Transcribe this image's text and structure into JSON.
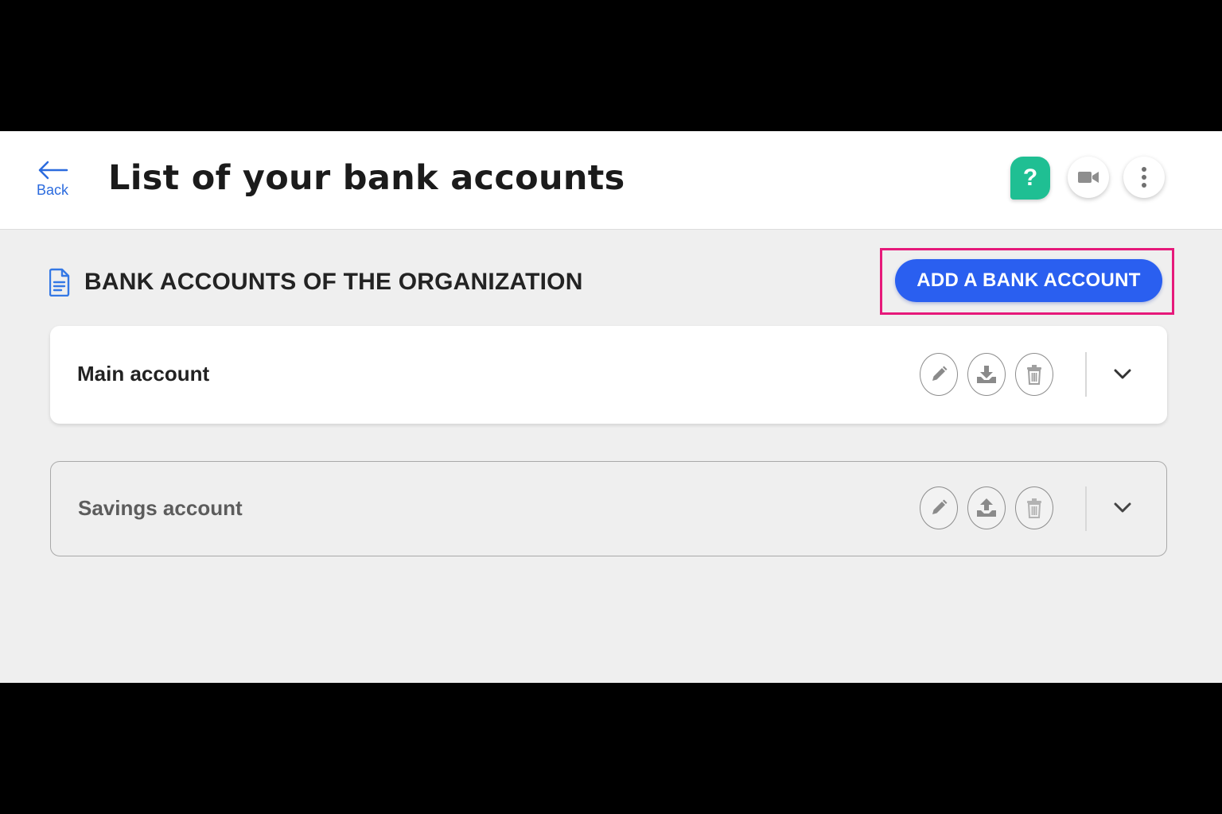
{
  "header": {
    "back_label": "Back",
    "title": "List of your bank accounts",
    "help_label": "?"
  },
  "section": {
    "title": "BANK ACCOUNTS OF THE ORGANIZATION",
    "add_button_label": "ADD A BANK ACCOUNT"
  },
  "accounts": [
    {
      "name": "Main account",
      "actions": [
        "pencil-icon",
        "download-icon",
        "trash-icon"
      ]
    },
    {
      "name": "Savings account",
      "actions": [
        "pencil-icon",
        "upload-icon",
        "trash-icon"
      ]
    }
  ],
  "colors": {
    "accent": "#2a5ff0",
    "help": "#1fbf93",
    "highlight": "#e6197a",
    "link": "#2b6bde"
  }
}
